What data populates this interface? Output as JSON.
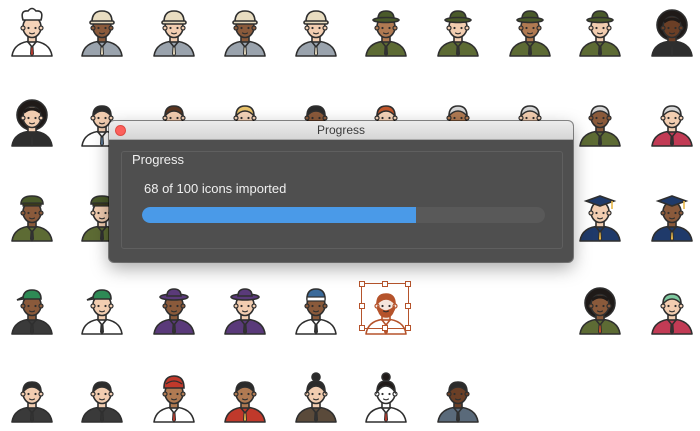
{
  "dialog": {
    "title": "Progress",
    "group_label": "Progress",
    "status_text": "68 of 100 icons imported",
    "imported_count": 68,
    "total_count": 100,
    "progress_fraction": 0.68
  },
  "colors": {
    "progress_fill": "#4a9ae8",
    "dialog_background": "#4f4f4f",
    "close_button": "#fc605c",
    "selection": "#b5532b"
  },
  "avatar_icons": [
    "chef-avatar-icon",
    "construction-worker-avatar-icon",
    "construction-worker-avatar-icon",
    "construction-worker-avatar-icon",
    "construction-worker-avatar-icon",
    "detective-avatar-icon",
    "detective-avatar-icon",
    "detective-avatar-icon",
    "detective-avatar-icon",
    "afro-woman-avatar-icon",
    "afro-woman-avatar-icon",
    "doctor-avatar-icon",
    "man-avatar-icon",
    "blonde-woman-avatar-icon",
    "woman-glasses-avatar-icon",
    "redhead-woman-avatar-icon",
    "old-man-avatar-icon",
    "old-man-avatar-icon",
    "old-woman-avatar-icon",
    "old-woman-glasses-avatar-icon",
    "military-officer-avatar-icon",
    "military-officer-avatar-icon",
    "graduate-avatar-icon",
    "graduate-avatar-icon",
    "cap-man-avatar-icon",
    "cap-man-avatar-icon",
    "hat-woman-avatar-icon",
    "hat-woman-avatar-icon",
    "beanie-man-avatar-icon",
    "bearded-man-avatar-icon",
    "afro-man-scarf-avatar-icon",
    "green-hair-woman-avatar-icon",
    "bearded-man-avatar-icon",
    "bearded-man-avatar-icon",
    "turban-man-avatar-icon",
    "indian-woman-avatar-icon",
    "topknot-man-avatar-icon",
    "geisha-avatar-icon",
    "bearded-man-avatar-icon"
  ]
}
